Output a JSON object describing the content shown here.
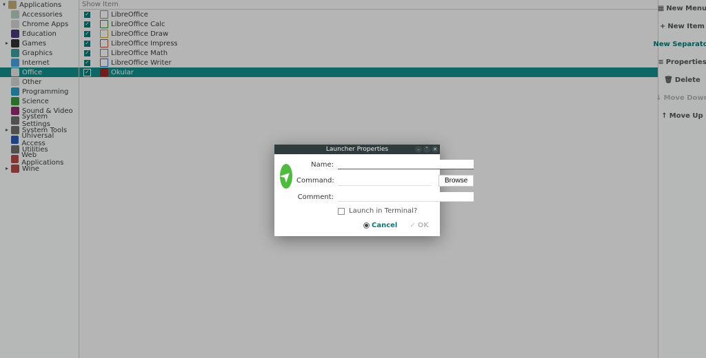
{
  "tree": {
    "root_label": "Applications",
    "items": [
      {
        "label": "Accessories",
        "icon_bg": "#b8cfc1"
      },
      {
        "label": "Chrome Apps",
        "icon_bg": "#d6d6d6"
      },
      {
        "label": "Education",
        "icon_bg": "#4a3a7a"
      },
      {
        "label": "Games",
        "icon_bg": "#333333",
        "expander": true
      },
      {
        "label": "Graphics",
        "icon_bg": "#3aa0a0"
      },
      {
        "label": "Internet",
        "icon_bg": "#4aa3e0"
      },
      {
        "label": "Office",
        "icon_bg": "#e7e7e7",
        "selected": true
      },
      {
        "label": "Other",
        "icon_bg": "#d6d6d6"
      },
      {
        "label": "Programming",
        "icon_bg": "#2aa0c5"
      },
      {
        "label": "Science",
        "icon_bg": "#3a9a3a"
      },
      {
        "label": "Sound & Video",
        "icon_bg": "#932f6f"
      },
      {
        "label": "System Settings",
        "icon_bg": "#6f6f6f"
      },
      {
        "label": "System Tools",
        "icon_bg": "#6f6f6f",
        "expander": true
      },
      {
        "label": "Universal Access",
        "icon_bg": "#2b5bb5"
      },
      {
        "label": "Utilities",
        "icon_bg": "#6f6f6f"
      },
      {
        "label": "Web Applications",
        "icon_bg": "#b44b4b"
      },
      {
        "label": "Wine",
        "icon_bg": "#b44b4b",
        "expander": true
      }
    ]
  },
  "list": {
    "col_show": "Show",
    "col_item": "Item",
    "rows": [
      {
        "label": "LibreOffice",
        "icon_bg": "#ffffff",
        "icon_border": "#888"
      },
      {
        "label": "LibreOffice Calc",
        "icon_bg": "#ffffff",
        "icon_border": "#2e8b2e"
      },
      {
        "label": "LibreOffice Draw",
        "icon_bg": "#ffffff",
        "icon_border": "#c9a227"
      },
      {
        "label": "LibreOffice Impress",
        "icon_bg": "#ffffff",
        "icon_border": "#b84b2e"
      },
      {
        "label": "LibreOffice Math",
        "icon_bg": "#ffffff",
        "icon_border": "#777777"
      },
      {
        "label": "LibreOffice Writer",
        "icon_bg": "#ffffff",
        "icon_border": "#2e6ab8"
      },
      {
        "label": "Okular",
        "icon_bg": "#a22828",
        "icon_border": "#a22828",
        "selected": true
      }
    ]
  },
  "sidebar": {
    "new_menu": "New Menu",
    "new_item": "New Item",
    "new_separator": "New Separator",
    "properties": "Properties",
    "delete": "Delete",
    "move_down": "Move Down",
    "move_up": "Move Up"
  },
  "dialog": {
    "title": "Launcher Properties",
    "name_label": "Name:",
    "command_label": "Command:",
    "comment_label": "Comment:",
    "browse_label": "Browse",
    "terminal_label": "Launch in Terminal?",
    "cancel_label": "Cancel",
    "ok_label": "OK",
    "name_value": "",
    "command_value": "",
    "comment_value": ""
  },
  "icons": {
    "plus": "+",
    "list": "≡",
    "trash": "🗑",
    "down": "↓",
    "up": "↑",
    "check": "✓",
    "close": "✕",
    "caret_right": "▸",
    "caret_down": "▾",
    "caret_up": "˄",
    "hyphen": "–"
  }
}
